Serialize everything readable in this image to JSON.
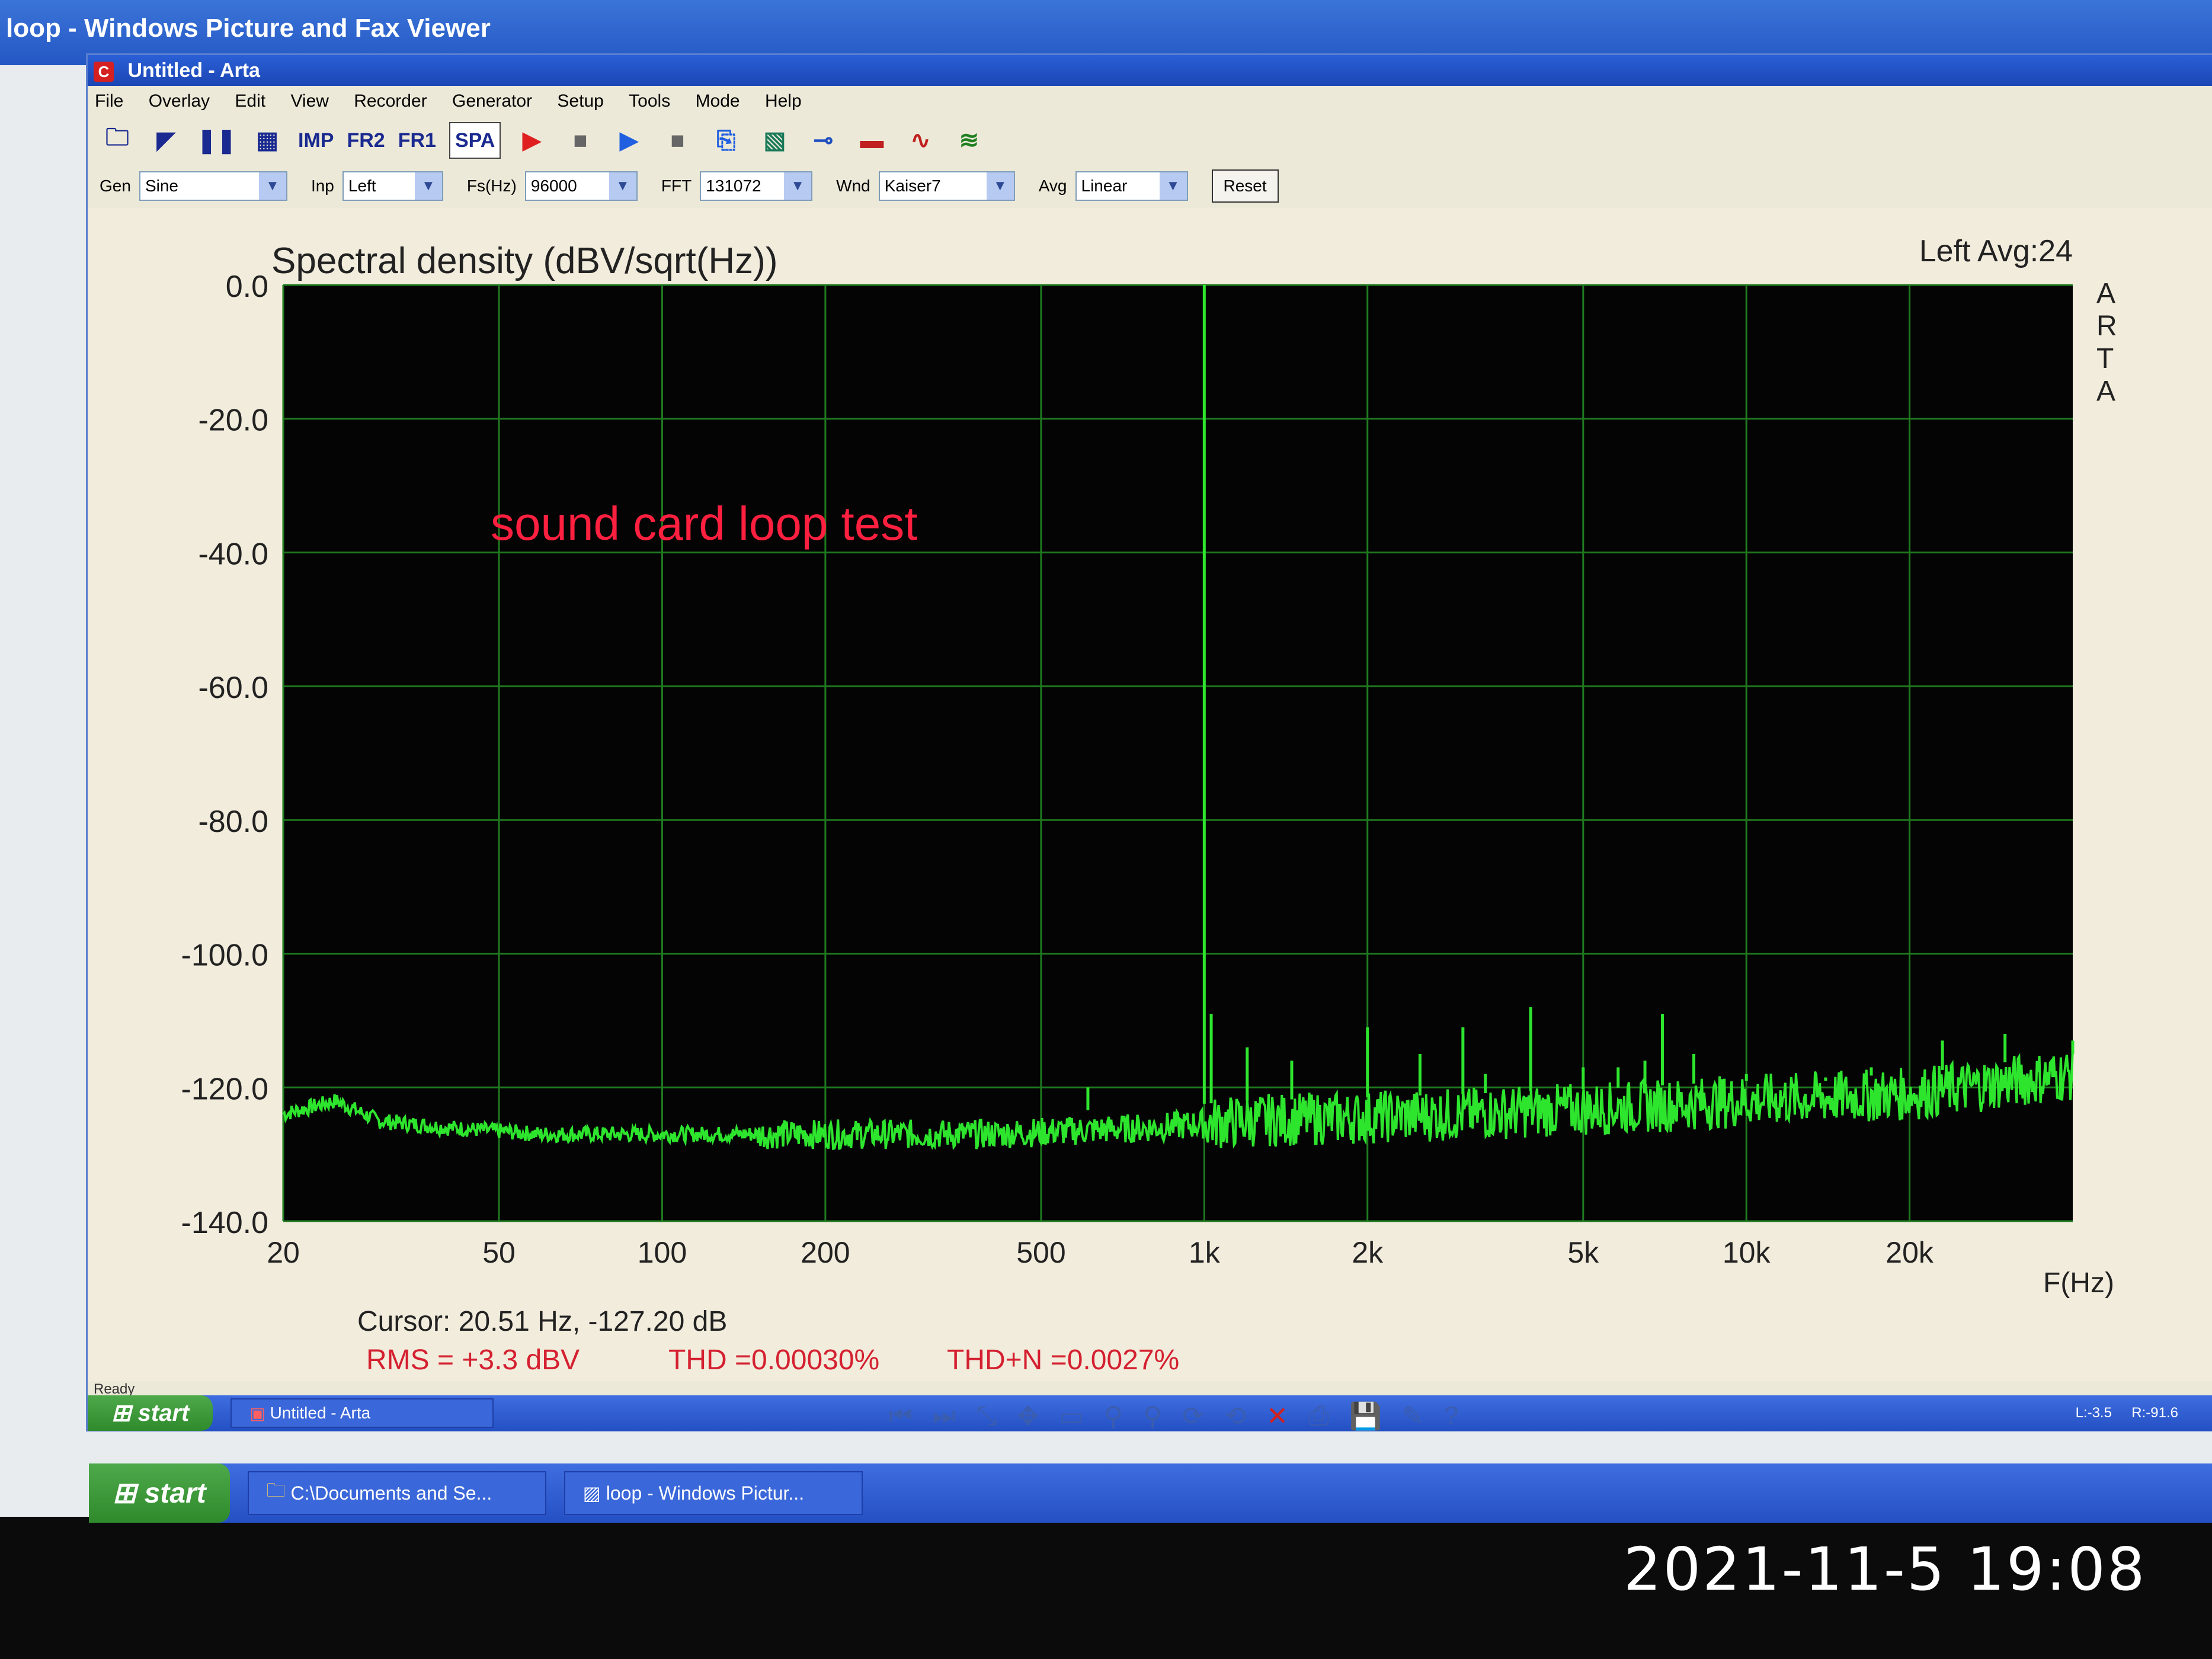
{
  "viewer": {
    "title": "loop - Windows Picture and Fax Viewer",
    "toolbar_icons": [
      "previous-icon",
      "next-icon",
      "best-fit-icon",
      "actual-size-icon",
      "slideshow-icon",
      "zoom-in-icon",
      "zoom-out-icon",
      "rotate-clockwise-icon",
      "rotate-counterclockwise-icon",
      "delete-icon",
      "print-icon",
      "save-icon",
      "edit-icon",
      "help-icon"
    ]
  },
  "arta": {
    "title": "Untitled - Arta",
    "menu": [
      "File",
      "Overlay",
      "Edit",
      "View",
      "Recorder",
      "Generator",
      "Setup",
      "Tools",
      "Mode",
      "Help"
    ],
    "toolbar_modes": [
      "IMP",
      "FR2",
      "FR1",
      "SPA"
    ],
    "active_mode": "SPA",
    "controls": {
      "gen_label": "Gen",
      "gen_value": "Sine",
      "inp_label": "Inp",
      "inp_value": "Left",
      "fs_label": "Fs(Hz)",
      "fs_value": "96000",
      "fft_label": "FFT",
      "fft_value": "131072",
      "wnd_label": "Wnd",
      "wnd_value": "Kaiser7",
      "avg_label": "Avg",
      "avg_value": "Linear",
      "reset_label": "Reset"
    },
    "status": "Ready",
    "inner_taskbar": {
      "start": "start",
      "task": "Untitled - Arta",
      "tray_left": "L:-3.5",
      "tray_right": "R:-91.6"
    }
  },
  "chart_data": {
    "type": "line",
    "title": "Spectral density (dBV/sqrt(Hz))",
    "channel_label": "Left  Avg:24",
    "brand_letters": [
      "A",
      "R",
      "T",
      "A"
    ],
    "xlabel": "F(Hz)",
    "x_scale": "log",
    "xlim": [
      20,
      40000
    ],
    "ylim": [
      -140,
      0
    ],
    "y_ticks": [
      "0.0",
      "-20.0",
      "-40.0",
      "-60.0",
      "-80.0",
      "-100.0",
      "-120.0",
      "-140.0"
    ],
    "x_ticks": [
      {
        "v": 20,
        "label": "20"
      },
      {
        "v": 50,
        "label": "50"
      },
      {
        "v": 100,
        "label": "100"
      },
      {
        "v": 200,
        "label": "200"
      },
      {
        "v": 500,
        "label": "500"
      },
      {
        "v": 1000,
        "label": "1k"
      },
      {
        "v": 2000,
        "label": "2k"
      },
      {
        "v": 5000,
        "label": "5k"
      },
      {
        "v": 10000,
        "label": "10k"
      },
      {
        "v": 20000,
        "label": "20k"
      }
    ],
    "annotation": "sound card loop test",
    "cursor_text": "Cursor: 20.51 Hz, -127.20 dB",
    "rms_text": "RMS =    +3.3 dBV",
    "thd_text": "THD =0.00030%",
    "thdn_text": "THD+N =0.0027%",
    "grid": true,
    "line_color": "#2ee52e",
    "background": "#040404",
    "noise_floor": [
      {
        "f": 20,
        "db": -124
      },
      {
        "f": 25,
        "db": -122
      },
      {
        "f": 30,
        "db": -125
      },
      {
        "f": 40,
        "db": -126
      },
      {
        "f": 60,
        "db": -127
      },
      {
        "f": 100,
        "db": -127
      },
      {
        "f": 200,
        "db": -127
      },
      {
        "f": 400,
        "db": -127
      },
      {
        "f": 800,
        "db": -126
      },
      {
        "f": 1200,
        "db": -125
      },
      {
        "f": 3000,
        "db": -124
      },
      {
        "f": 6000,
        "db": -123
      },
      {
        "f": 10000,
        "db": -122
      },
      {
        "f": 20000,
        "db": -121
      },
      {
        "f": 40000,
        "db": -118
      }
    ],
    "peaks": [
      {
        "f": 1000,
        "db": 0
      },
      {
        "f": 610,
        "db": -120
      },
      {
        "f": 1030,
        "db": -109
      },
      {
        "f": 1200,
        "db": -114
      },
      {
        "f": 1450,
        "db": -116
      },
      {
        "f": 2000,
        "db": -111
      },
      {
        "f": 2500,
        "db": -115
      },
      {
        "f": 3000,
        "db": -111
      },
      {
        "f": 3300,
        "db": -118
      },
      {
        "f": 4000,
        "db": -108
      },
      {
        "f": 5000,
        "db": -117
      },
      {
        "f": 5800,
        "db": -117
      },
      {
        "f": 6500,
        "db": -116
      },
      {
        "f": 7000,
        "db": -109
      },
      {
        "f": 8000,
        "db": -115
      },
      {
        "f": 9000,
        "db": -119
      },
      {
        "f": 10000,
        "db": -118
      },
      {
        "f": 14000,
        "db": -119
      },
      {
        "f": 17000,
        "db": -117
      },
      {
        "f": 23000,
        "db": -113
      },
      {
        "f": 30000,
        "db": -112
      },
      {
        "f": 40000,
        "db": -113
      }
    ]
  },
  "outer_taskbar": {
    "start": "start",
    "items": [
      "C:\\Documents and Se...",
      "loop - Windows Pictur..."
    ]
  },
  "timestamp": "2021-11-5 19:08"
}
